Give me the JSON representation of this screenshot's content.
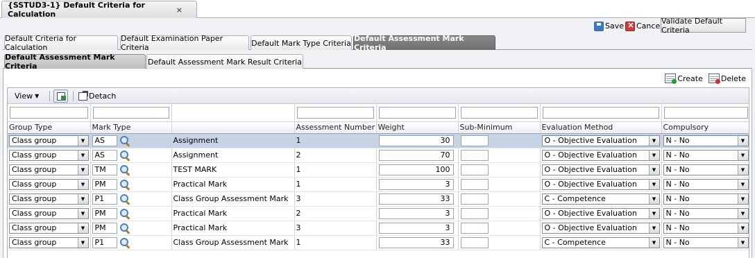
{
  "window_tab": {
    "title": "{SSTUD3-1} Default Criteria for Calculation",
    "close": "×"
  },
  "toolbar": {
    "save": "Save",
    "cancel": "Cancel",
    "validate": "Validate Default Criteria"
  },
  "tabs_main": [
    {
      "label": "Default Criteria for Calculation"
    },
    {
      "label": "Default Examination Paper Criteria"
    },
    {
      "label": "Default Mark Type Criteria"
    },
    {
      "label": "Default Assessment Mark Criteria"
    }
  ],
  "tabs_sub": [
    {
      "label": "Default Assessment Mark Criteria"
    },
    {
      "label": "Default Assessment Mark Result Criteria"
    }
  ],
  "actions": {
    "create": "Create",
    "delete": "Delete"
  },
  "grid_toolbar": {
    "view": "View",
    "detach": "Detach"
  },
  "columns": [
    "Group Type",
    "Mark Type",
    "",
    "Assessment Number",
    "Weight",
    "Sub-Minimum",
    "Evaluation Method",
    "Compulsory"
  ],
  "rows": [
    {
      "group": "Class group",
      "code": "AS",
      "desc": "Assignment",
      "num": "1",
      "weight": "30",
      "sub": "",
      "eval": "O - Objective Evaluation",
      "comp": "N - No"
    },
    {
      "group": "Class group",
      "code": "AS",
      "desc": "Assignment",
      "num": "2",
      "weight": "70",
      "sub": "",
      "eval": "O - Objective Evaluation",
      "comp": "N - No"
    },
    {
      "group": "Class group",
      "code": "TM",
      "desc": "TEST MARK",
      "num": "1",
      "weight": "100",
      "sub": "",
      "eval": "O - Objective Evaluation",
      "comp": "N - No"
    },
    {
      "group": "Class group",
      "code": "PM",
      "desc": "Practical Mark",
      "num": "1",
      "weight": "3",
      "sub": "",
      "eval": "O - Objective Evaluation",
      "comp": "N - No"
    },
    {
      "group": "Class group",
      "code": "P1",
      "desc": "Class Group Assessment Mark",
      "num": "3",
      "weight": "33",
      "sub": "",
      "eval": "C - Competence",
      "comp": "N - No"
    },
    {
      "group": "Class group",
      "code": "PM",
      "desc": "Practical Mark",
      "num": "2",
      "weight": "3",
      "sub": "",
      "eval": "O - Objective Evaluation",
      "comp": "N - No"
    },
    {
      "group": "Class group",
      "code": "PM",
      "desc": "Practical Mark",
      "num": "3",
      "weight": "3",
      "sub": "",
      "eval": "O - Objective Evaluation",
      "comp": "N - No"
    },
    {
      "group": "Class group",
      "code": "P1",
      "desc": "Class Group Assessment Mark",
      "num": "1",
      "weight": "33",
      "sub": "",
      "eval": "C - Competence",
      "comp": "N - No"
    }
  ]
}
